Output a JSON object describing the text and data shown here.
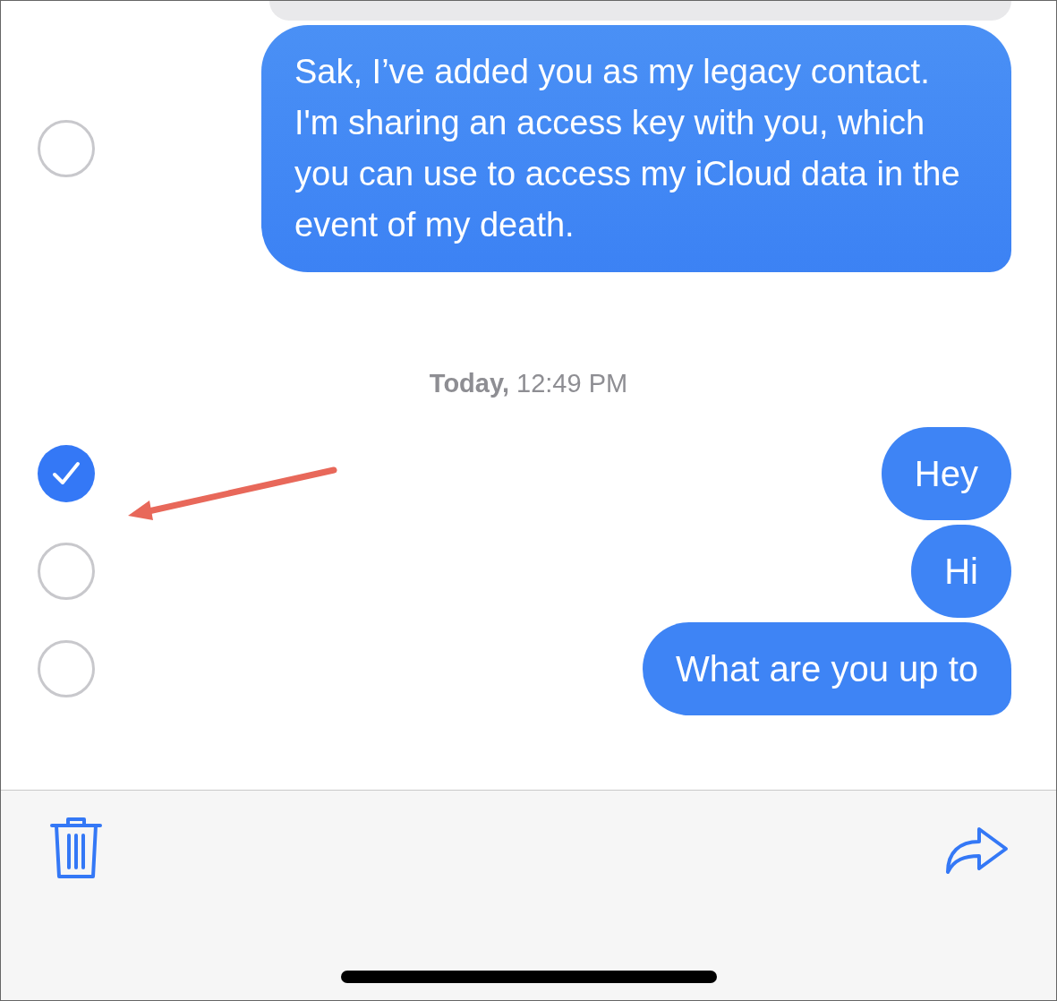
{
  "items": [
    {
      "kind": "message",
      "text": "Sak, I’ve added you as my legacy contact. I'm sharing an access key with you, which you can use to access my iCloud data in the event of my death.",
      "selected": false,
      "tail": true
    },
    {
      "kind": "timestamp",
      "text": "**Today,** 12:49 PM"
    },
    {
      "kind": "message",
      "text": "Hey",
      "selected": true,
      "tail": false
    },
    {
      "kind": "message",
      "text": "Hi",
      "selected": false,
      "tail": false
    },
    {
      "kind": "message",
      "text": "What are you up to",
      "selected": false,
      "tail": true
    }
  ]
}
